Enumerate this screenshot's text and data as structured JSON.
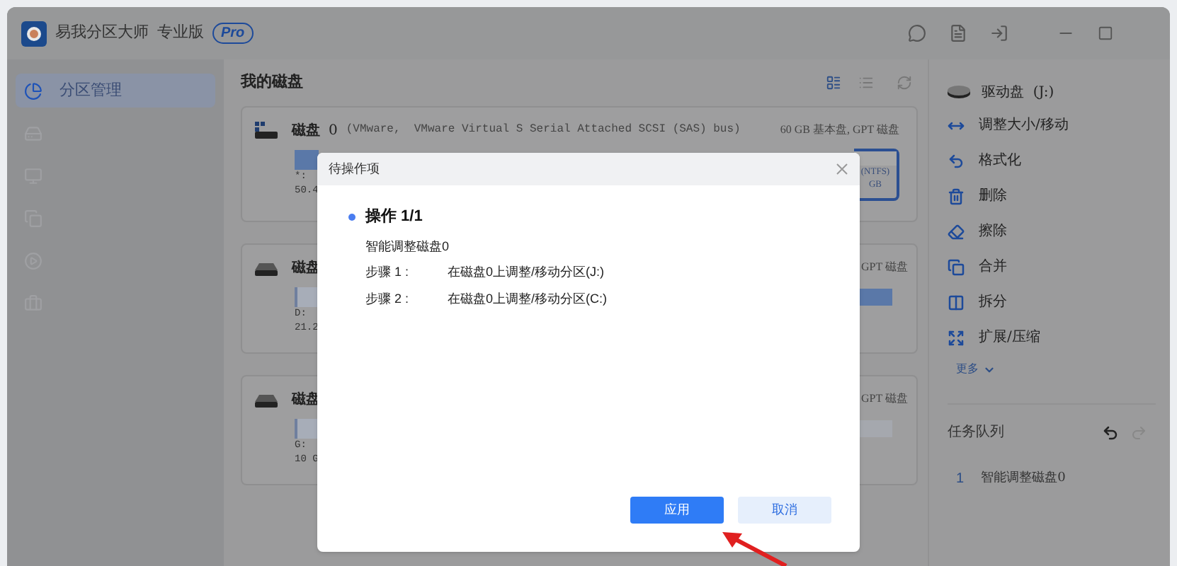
{
  "app": {
    "title": "易我分区大师",
    "edition": "专业版",
    "badge": "Pro"
  },
  "sidebar": {
    "items": [
      {
        "label": "分区管理",
        "selected": true
      },
      {
        "selected": false
      },
      {
        "selected": false
      },
      {
        "selected": false
      },
      {
        "selected": false
      },
      {
        "selected": false
      }
    ]
  },
  "main": {
    "title": "我的磁盘",
    "disks": [
      {
        "name": "磁盘",
        "number": "0",
        "description": "(VMware,  VMware Virtual S Serial Attached SCSI (SAS) bus)",
        "summary": "60 GB 基本盘, GPT 磁盘",
        "left_lines": [
          "*:",
          "50.4"
        ],
        "right_lines": [
          "(NTFS)",
          "GB"
        ],
        "right_selected": true
      },
      {
        "name": "磁盘",
        "summary": "GPT 磁盘",
        "left_lines": [
          "D:",
          "21.2"
        ],
        "right_selected": false
      },
      {
        "name": "磁盘",
        "summary": "GPT 磁盘",
        "left_lines": [
          "G:",
          "10 G"
        ],
        "right_selected": false
      }
    ]
  },
  "right_panel": {
    "drive": "驱动盘  (J:)",
    "actions": [
      "调整大小/移动",
      "格式化",
      "删除",
      "擦除",
      "合并",
      "拆分",
      "扩展/压缩"
    ],
    "more": "更多",
    "task_queue": {
      "title": "任务队列",
      "tasks": [
        {
          "index": "1",
          "label": "智能调整磁盘0"
        }
      ]
    }
  },
  "dialog": {
    "title": "待操作项",
    "operation": "操作 1/1",
    "task": "智能调整磁盘0",
    "steps": [
      {
        "label": "步骤 1 :",
        "text": "在磁盘0上调整/移动分区(J:)"
      },
      {
        "label": "步骤 2 :",
        "text": "在磁盘0上调整/移动分区(C:)"
      }
    ],
    "buttons": [
      {
        "label": "应用",
        "kind": "primary"
      },
      {
        "label": "取消",
        "kind": "secondary"
      }
    ]
  }
}
